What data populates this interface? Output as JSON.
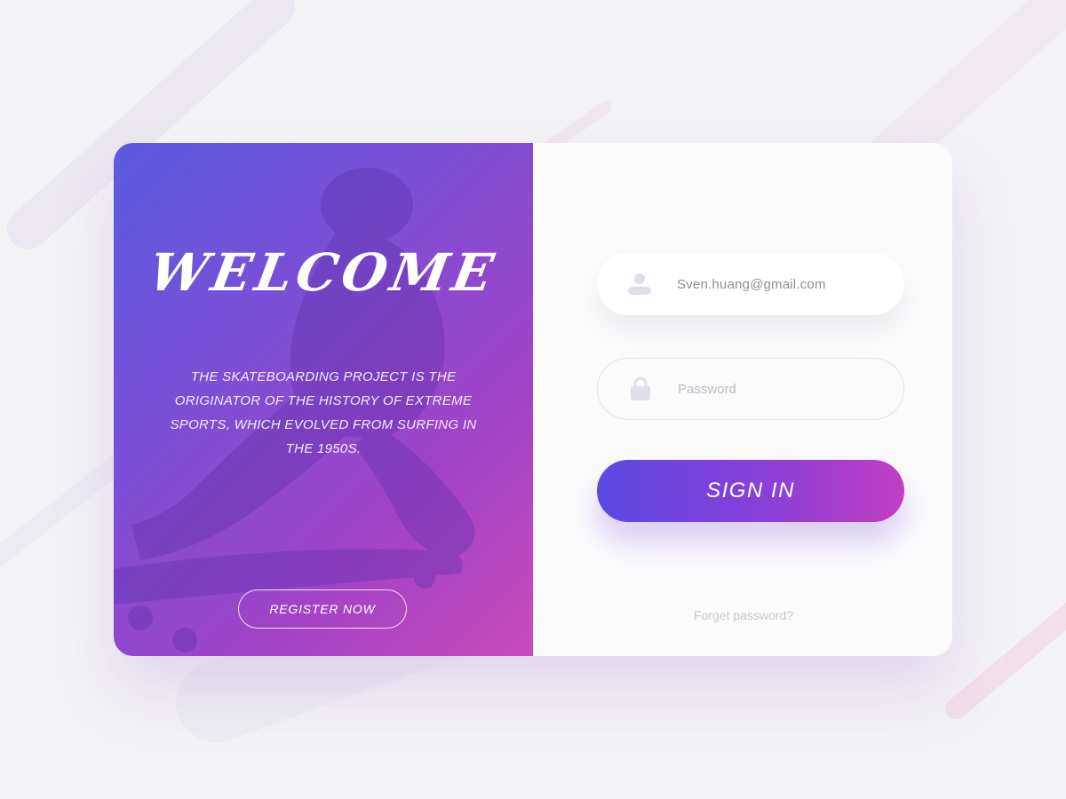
{
  "left_panel": {
    "title": "WELCOME",
    "tagline": "The skateboarding project is the originator of the history of extreme sports, which evolved from surfing in the 1950s.",
    "register_label": "REGISTER NOW",
    "gradient_colors": [
      "#5b5bdf",
      "#a143c6",
      "#c84bbd"
    ]
  },
  "login_form": {
    "email": {
      "value": "Sven.huang@gmail.com",
      "icon": "user-icon"
    },
    "password": {
      "placeholder": "Password",
      "icon": "lock-icon"
    },
    "signin_label": "SIGN IN",
    "signin_gradient": [
      "#5a49e2",
      "#c23ec5"
    ],
    "forget_label": "Forget password?"
  }
}
